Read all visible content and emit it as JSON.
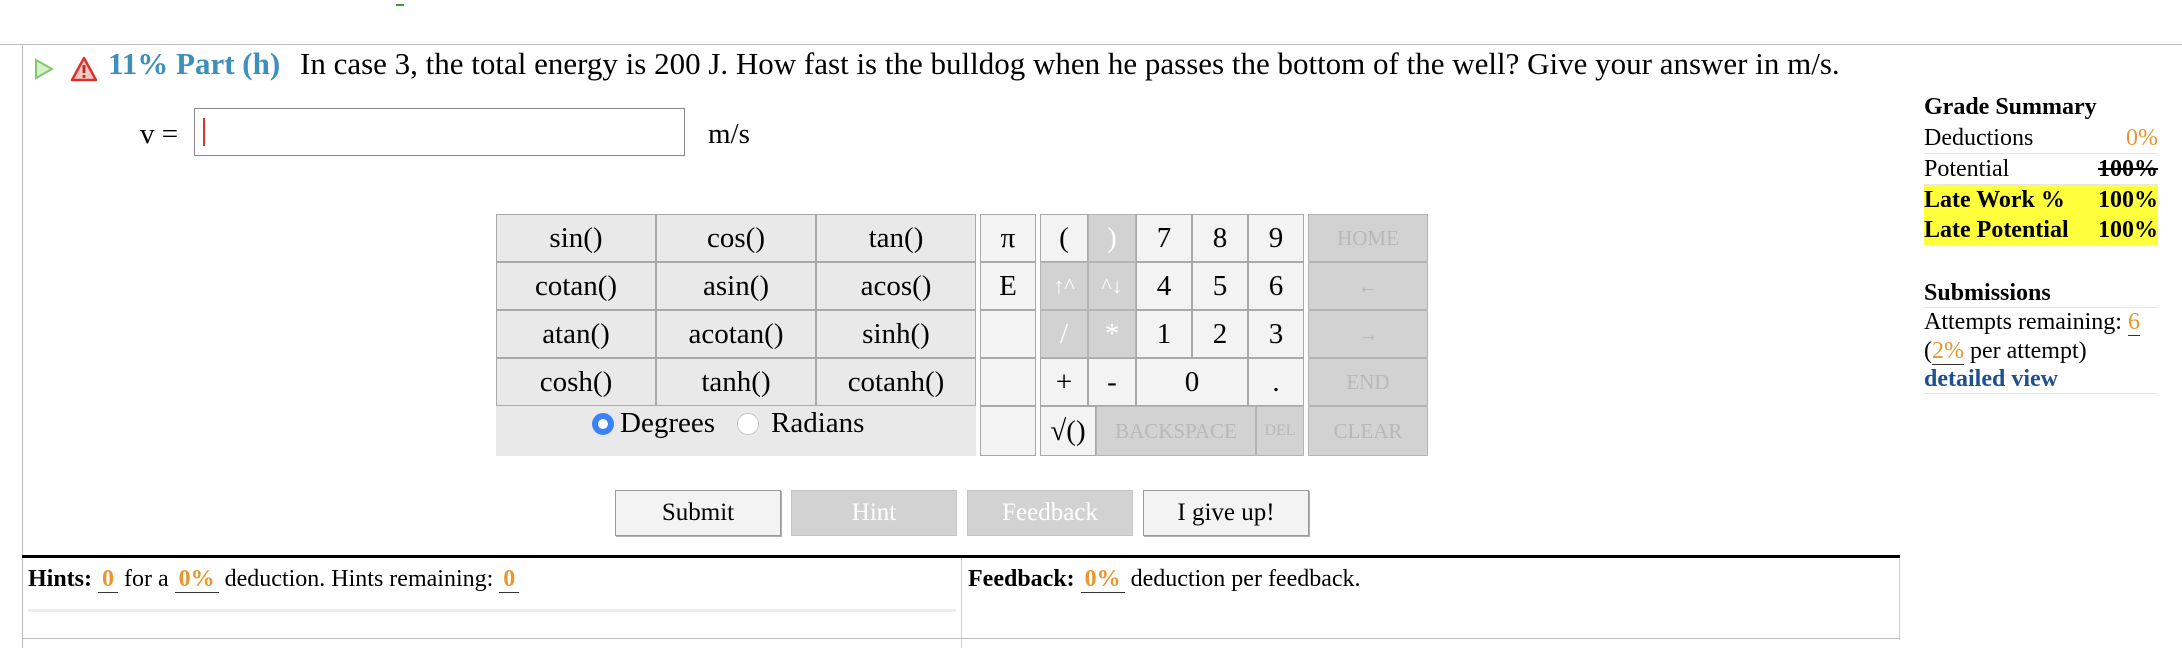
{
  "part": {
    "label": "11% Part (h)",
    "question": "In case 3, the total energy is 200 J. How fast is the bulldog when he passes the bottom of the well? Give your answer in m/s."
  },
  "answer": {
    "variable": "v =",
    "value": "",
    "unit": "m/s"
  },
  "keypad": {
    "functions": [
      "sin()",
      "cos()",
      "tan()",
      "cotan()",
      "asin()",
      "acos()",
      "atan()",
      "acotan()",
      "sinh()",
      "cosh()",
      "tanh()",
      "cotanh()"
    ],
    "symbols": {
      "pi": "π",
      "e": "E",
      "open_paren": "(",
      "close_paren": ")",
      "up": "↑^",
      "down": "^↓",
      "divide": "/",
      "multiply": "*",
      "plus": "+",
      "minus": "-",
      "sqrt": "√()",
      "decimal": "."
    },
    "digits": {
      "d7": "7",
      "d8": "8",
      "d9": "9",
      "d4": "4",
      "d5": "5",
      "d6": "6",
      "d1": "1",
      "d2": "2",
      "d3": "3",
      "d0": "0"
    },
    "nav": {
      "home": "HOME",
      "left": "←",
      "right": "→",
      "end": "END",
      "backspace": "BACKSPACE",
      "del": "DEL",
      "clear": "CLEAR"
    },
    "angle": {
      "degrees": "Degrees",
      "radians": "Radians",
      "selected": "Degrees"
    }
  },
  "buttons": {
    "submit": "Submit",
    "hint": "Hint",
    "feedback": "Feedback",
    "give_up": "I give up!"
  },
  "hints": {
    "label": "Hints:",
    "count": "0",
    "for_a": "for a",
    "deduction_pct": "0%",
    "deduction_text": "deduction. Hints remaining:",
    "remaining": "0"
  },
  "feedback": {
    "label": "Feedback:",
    "pct": "0%",
    "text": "deduction per feedback."
  },
  "grade_summary": {
    "title": "Grade Summary",
    "deductions_label": "Deductions",
    "deductions_value": "0%",
    "potential_label": "Potential",
    "potential_value": "100%",
    "late_work_label": "Late Work %",
    "late_work_value": "100%",
    "late_potential_label": "Late Potential",
    "late_potential_value": "100%"
  },
  "submissions": {
    "title": "Submissions",
    "attempts_label": "Attempts remaining:",
    "attempts_value": "6",
    "per_attempt_pct": "2%",
    "per_attempt_text": "per attempt)",
    "open_paren": "(",
    "detailed_view": "detailed view"
  },
  "colors": {
    "part_blue": "#3d8fbd",
    "orange": "#e8962f",
    "highlight": "#ffff3b",
    "link": "#1f4f8f",
    "warning_red": "#e0312d",
    "play_green": "#7ec86a"
  }
}
